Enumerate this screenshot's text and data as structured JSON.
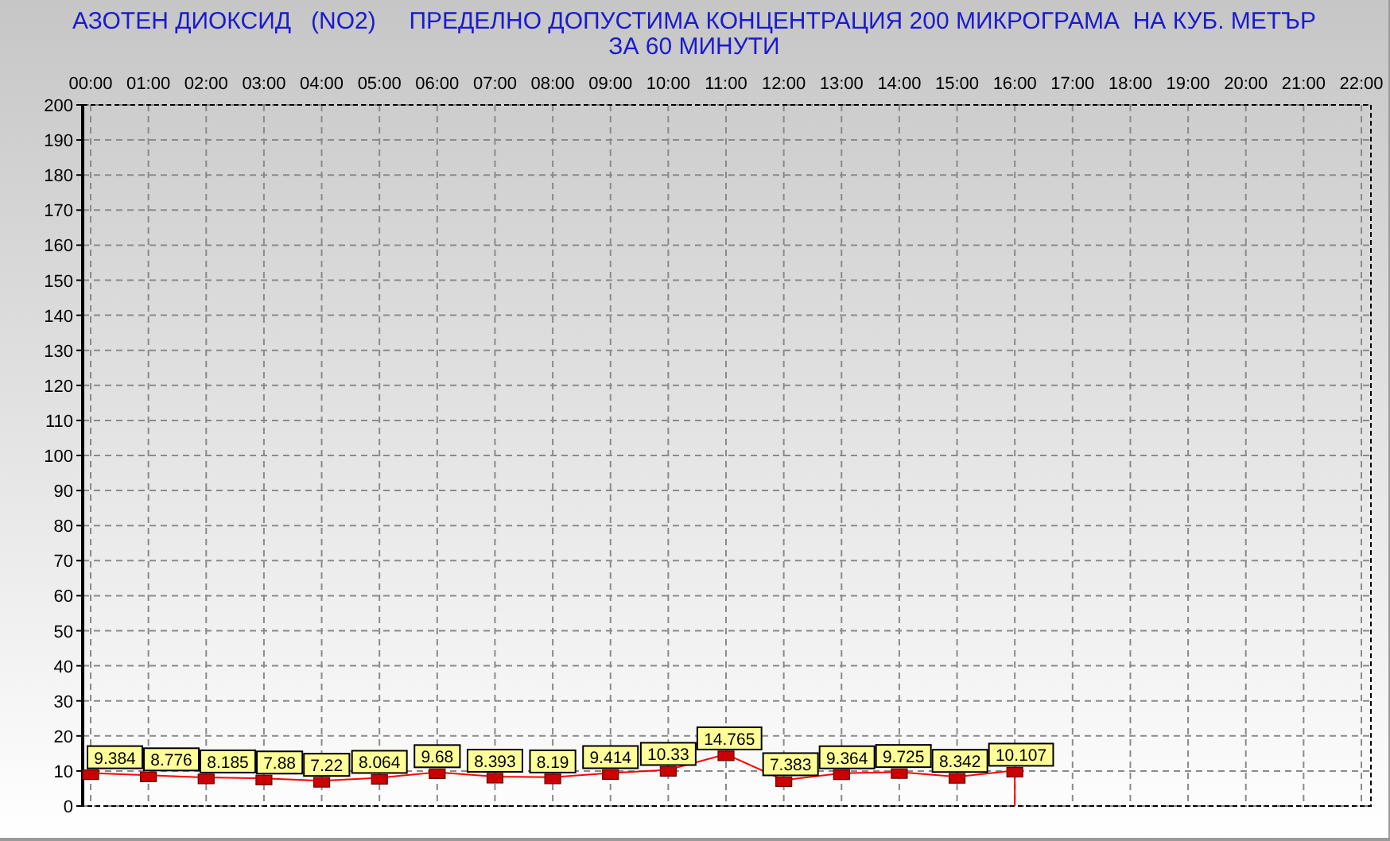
{
  "title": {
    "line_1": "АЗОТЕН ДИОКСИД   (NO2)     ПРЕДЕЛНО ДОПУСТИМА КОНЦЕНТРАЦИЯ 200 МИКРОГРАМА  НА КУБ. МЕТЪР",
    "line_2": "ЗА 60 МИНУТИ"
  },
  "chart_data": {
    "type": "line",
    "categories": [
      "00:00",
      "01:00",
      "02:00",
      "03:00",
      "04:00",
      "05:00",
      "06:00",
      "07:00",
      "08:00",
      "09:00",
      "10:00",
      "11:00",
      "12:00",
      "13:00",
      "14:00",
      "15:00",
      "16:00",
      "17:00",
      "18:00",
      "19:00",
      "20:00",
      "21:00",
      "22:00"
    ],
    "grid": true,
    "series": [
      {
        "color": "#ff0000",
        "marker": "square",
        "values": [
          9.384,
          8.776,
          8.185,
          7.88,
          7.22,
          8.064,
          9.68,
          8.393,
          8.19,
          9.414,
          10.33,
          14.765,
          7.383,
          9.364,
          9.725,
          8.342,
          10.107,
          null,
          null,
          null,
          null,
          null,
          null
        ]
      }
    ],
    "ylim": [
      0,
      200
    ],
    "yticks": [
      0,
      10,
      20,
      30,
      40,
      50,
      60,
      70,
      80,
      90,
      100,
      110,
      120,
      130,
      140,
      150,
      160,
      170,
      180,
      190,
      200
    ],
    "data_labels": true
  }
}
